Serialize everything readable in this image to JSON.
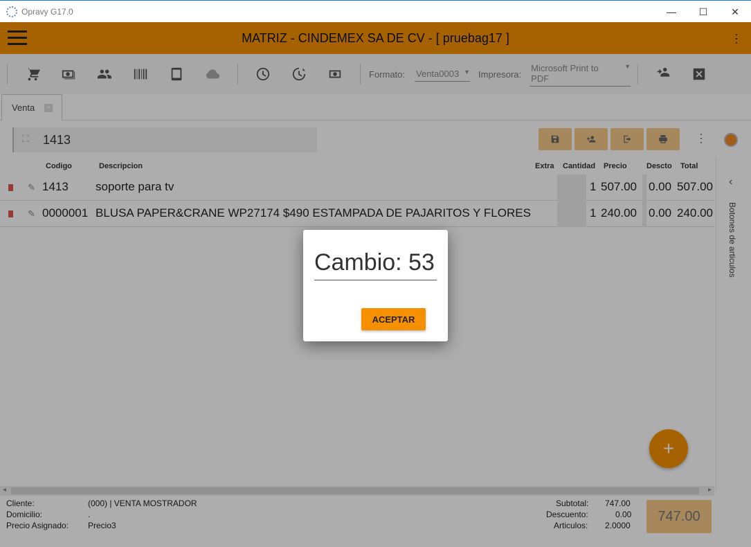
{
  "window": {
    "title": "Opravy G17.0",
    "controls": {
      "minimize": "—",
      "maximize": "☐",
      "close": "✕"
    }
  },
  "appbar": {
    "title": "MATRIZ - CINDEMEX SA DE CV - [ pruebag17 ]"
  },
  "toolbar": {
    "icons": [
      "cart-icon",
      "cash-icon",
      "people-icon",
      "barcode-icon",
      "tablet-icon",
      "cloud-icon",
      "clock-icon",
      "clock-history-icon",
      "money-icon"
    ],
    "formato_label": "Formato:",
    "formato_value": "Venta0003",
    "impresora_label": "Impresora:",
    "impresora_value": "Microsoft Print to PDF"
  },
  "tabs": [
    {
      "label": "Venta",
      "close": "×"
    }
  ],
  "search": {
    "value": "1413",
    "scan_icon": "⛶"
  },
  "grid": {
    "columns": {
      "codigo": "Codigo",
      "descripcion": "Descripcion",
      "extra": "Extra",
      "cantidad": "Cantidad",
      "precio": "Precio",
      "descto": "Descto",
      "total": "Total"
    },
    "rows": [
      {
        "codigo": "1413",
        "descripcion": "soporte para tv",
        "cantidad": "1",
        "precio": "507.00",
        "descto": "0.00",
        "total": "507.00"
      },
      {
        "codigo": "0000001",
        "descripcion": "BLUSA PAPER&CRANE WP27174 $490 ESTAMPADA DE PAJARITOS Y FLORES",
        "cantidad": "1",
        "precio": "240.00",
        "descto": "0.00",
        "total": "240.00"
      }
    ]
  },
  "side_panel": {
    "label": "Botones de articulos",
    "chevron": "‹"
  },
  "fab": {
    "label": "+"
  },
  "footer": {
    "cliente_label": "Cliente:",
    "cliente_value": "(000) | VENTA MOSTRADOR",
    "domicilio_label": "Domicilio:",
    "domicilio_value": ".",
    "precio_label": "Precio Asignado:",
    "precio_value": "Precio3",
    "subtotal_label": "Subtotal:",
    "subtotal_value": "747.00",
    "descuento_label": "Descuento:",
    "descuento_value": "0.00",
    "articulos_label": "Articulos:",
    "articulos_value": "2.0000",
    "total_value": "747.00"
  },
  "dialog": {
    "text": "Cambio: 53",
    "button": "ACEPTAR"
  },
  "colors": {
    "accent": "#f59100",
    "accent_light": "#f7c989",
    "overlay": "rgba(0,0,0,0.32)"
  }
}
